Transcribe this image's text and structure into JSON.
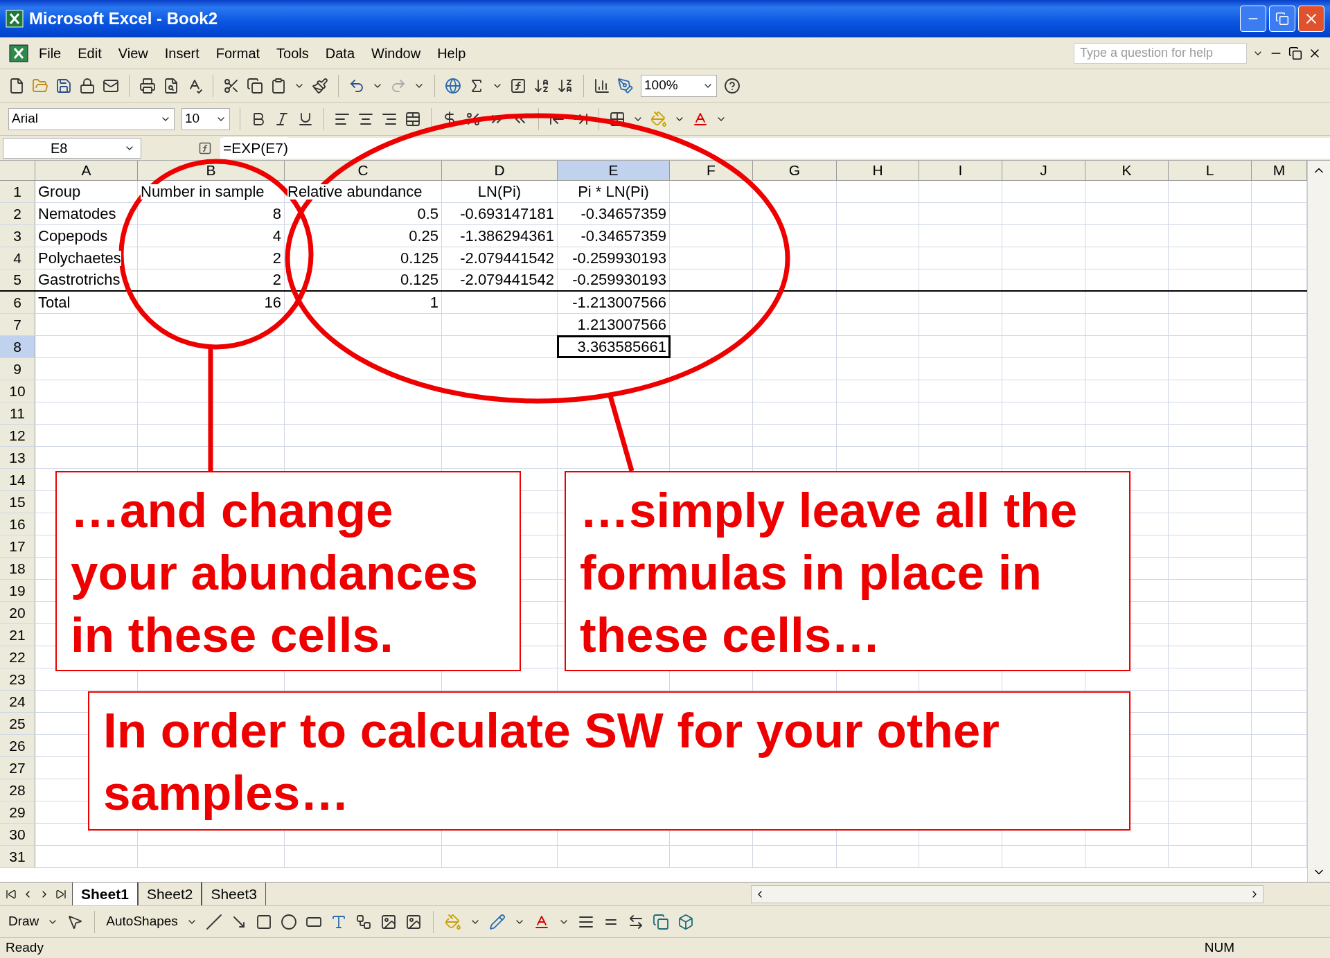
{
  "window": {
    "title": "Microsoft Excel - Book2"
  },
  "menu": [
    "File",
    "Edit",
    "View",
    "Insert",
    "Format",
    "Tools",
    "Data",
    "Window",
    "Help"
  ],
  "help_box": {
    "placeholder": "Type a question for help"
  },
  "toolbar": {
    "zoom": "100%",
    "font": "Arial",
    "size": "10"
  },
  "formula_bar": {
    "name_box": "E8",
    "formula": "=EXP(E7)"
  },
  "columns": [
    {
      "label": "A",
      "selected": false
    },
    {
      "label": "B",
      "selected": false
    },
    {
      "label": "C",
      "selected": false
    },
    {
      "label": "D",
      "selected": false
    },
    {
      "label": "E",
      "selected": true
    },
    {
      "label": "F",
      "selected": false
    },
    {
      "label": "G",
      "selected": false
    },
    {
      "label": "H",
      "selected": false
    },
    {
      "label": "I",
      "selected": false
    },
    {
      "label": "J",
      "selected": false
    },
    {
      "label": "K",
      "selected": false
    },
    {
      "label": "L",
      "selected": false
    },
    {
      "label": "M",
      "selected": false
    }
  ],
  "rows": [
    {
      "label": "1",
      "selected": false,
      "rule_below": false,
      "cells": [
        {
          "text": "Group",
          "kind": "text"
        },
        {
          "text": "Number in sample",
          "kind": "text"
        },
        {
          "text": "Relative abundance",
          "kind": "text"
        },
        {
          "text": "LN(Pi)",
          "kind": "heading"
        },
        {
          "text": "Pi * LN(Pi)",
          "kind": "heading"
        }
      ]
    },
    {
      "label": "2",
      "selected": false,
      "rule_below": false,
      "cells": [
        {
          "text": "Nematodes",
          "kind": "text"
        },
        {
          "text": "8",
          "kind": "number"
        },
        {
          "text": "0.5",
          "kind": "number"
        },
        {
          "text": "-0.693147181",
          "kind": "number"
        },
        {
          "text": "-0.34657359",
          "kind": "number"
        }
      ]
    },
    {
      "label": "3",
      "selected": false,
      "rule_below": false,
      "cells": [
        {
          "text": "Copepods",
          "kind": "text"
        },
        {
          "text": "4",
          "kind": "number"
        },
        {
          "text": "0.25",
          "kind": "number"
        },
        {
          "text": "-1.386294361",
          "kind": "number"
        },
        {
          "text": "-0.34657359",
          "kind": "number"
        }
      ]
    },
    {
      "label": "4",
      "selected": false,
      "rule_below": false,
      "cells": [
        {
          "text": "Polychaetes",
          "kind": "text"
        },
        {
          "text": "2",
          "kind": "number"
        },
        {
          "text": "0.125",
          "kind": "number"
        },
        {
          "text": "-2.079441542",
          "kind": "number"
        },
        {
          "text": "-0.259930193",
          "kind": "number"
        }
      ]
    },
    {
      "label": "5",
      "selected": false,
      "rule_below": true,
      "cells": [
        {
          "text": "Gastrotrichs",
          "kind": "text"
        },
        {
          "text": "2",
          "kind": "number"
        },
        {
          "text": "0.125",
          "kind": "number"
        },
        {
          "text": "-2.079441542",
          "kind": "number"
        },
        {
          "text": "-0.259930193",
          "kind": "number"
        }
      ]
    },
    {
      "label": "6",
      "selected": false,
      "rule_below": false,
      "cells": [
        {
          "text": "Total",
          "kind": "text"
        },
        {
          "text": "16",
          "kind": "number"
        },
        {
          "text": "1",
          "kind": "number"
        },
        null,
        {
          "text": "-1.213007566",
          "kind": "number"
        }
      ]
    },
    {
      "label": "7",
      "selected": false,
      "rule_below": false,
      "cells": [
        null,
        null,
        null,
        null,
        {
          "text": "1.213007566",
          "kind": "number"
        }
      ]
    },
    {
      "label": "8",
      "selected": true,
      "rule_below": false,
      "cells": [
        null,
        null,
        null,
        null,
        {
          "text": "3.363585661",
          "kind": "number",
          "selected": true
        }
      ]
    },
    {
      "label": "9",
      "selected": false,
      "rule_below": false,
      "cells": []
    },
    {
      "label": "10",
      "selected": false,
      "rule_below": false,
      "cells": []
    },
    {
      "label": "11",
      "selected": false,
      "rule_below": false,
      "cells": []
    },
    {
      "label": "12",
      "selected": false,
      "rule_below": false,
      "cells": []
    },
    {
      "label": "13",
      "selected": false,
      "rule_below": false,
      "cells": []
    },
    {
      "label": "14",
      "selected": false,
      "rule_below": false,
      "cells": []
    },
    {
      "label": "15",
      "selected": false,
      "rule_below": false,
      "cells": []
    },
    {
      "label": "16",
      "selected": false,
      "rule_below": false,
      "cells": []
    },
    {
      "label": "17",
      "selected": false,
      "rule_below": false,
      "cells": []
    },
    {
      "label": "18",
      "selected": false,
      "rule_below": false,
      "cells": []
    },
    {
      "label": "19",
      "selected": false,
      "rule_below": false,
      "cells": []
    },
    {
      "label": "20",
      "selected": false,
      "rule_below": false,
      "cells": []
    },
    {
      "label": "21",
      "selected": false,
      "rule_below": false,
      "cells": []
    },
    {
      "label": "22",
      "selected": false,
      "rule_below": false,
      "cells": []
    },
    {
      "label": "23",
      "selected": false,
      "rule_below": false,
      "cells": []
    },
    {
      "label": "24",
      "selected": false,
      "rule_below": false,
      "cells": []
    },
    {
      "label": "25",
      "selected": false,
      "rule_below": false,
      "cells": []
    },
    {
      "label": "26",
      "selected": false,
      "rule_below": false,
      "cells": []
    },
    {
      "label": "27",
      "selected": false,
      "rule_below": false,
      "cells": []
    },
    {
      "label": "28",
      "selected": false,
      "rule_below": false,
      "cells": []
    },
    {
      "label": "29",
      "selected": false,
      "rule_below": false,
      "cells": []
    },
    {
      "label": "30",
      "selected": false,
      "rule_below": false,
      "cells": []
    },
    {
      "label": "31",
      "selected": false,
      "rule_below": false,
      "cells": []
    }
  ],
  "sheet_tabs": [
    {
      "label": "Sheet1",
      "selected": true
    },
    {
      "label": "Sheet2",
      "selected": false
    },
    {
      "label": "Sheet3",
      "selected": false
    }
  ],
  "drawing_toolbar": {
    "draw": "Draw",
    "autoshapes": "AutoShapes"
  },
  "status_bar": {
    "status": "Ready",
    "num": "NUM"
  },
  "callouts": [
    {
      "lines": [
        "…and change",
        "your abundances",
        "in these cells."
      ]
    },
    {
      "lines": [
        "…simply leave all the",
        "formulas in place in",
        "these cells…"
      ]
    },
    {
      "lines": [
        "In order to calculate SW for your other",
        "samples…"
      ]
    }
  ]
}
